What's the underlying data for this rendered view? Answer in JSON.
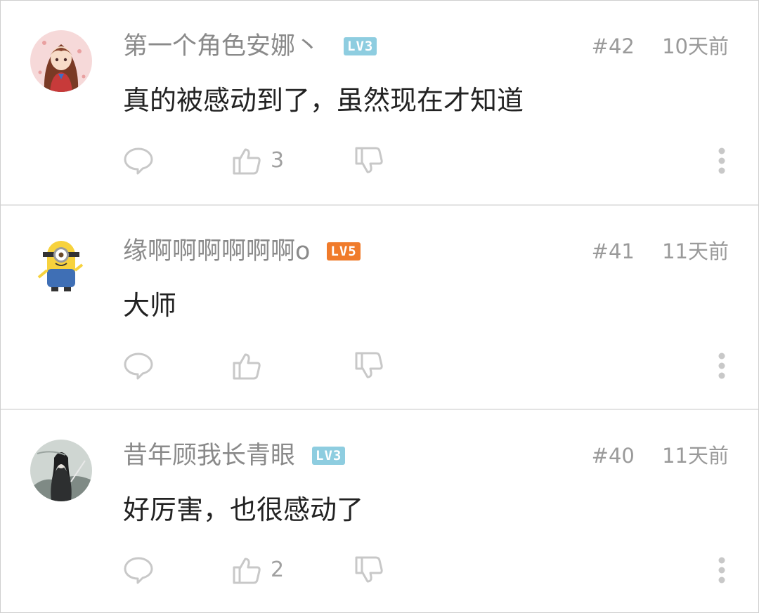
{
  "comments": [
    {
      "username": "第一个角色安娜丶",
      "level": "LV3",
      "floor": "#42",
      "time": "10天前",
      "text": "真的被感动到了，虽然现在才知道",
      "likes": "3",
      "avatar_icon": "anime-girl-avatar",
      "level_color": "#8ecde0"
    },
    {
      "username": "缘啊啊啊啊啊啊o",
      "level": "LV5",
      "floor": "#41",
      "time": "11天前",
      "text": "大师",
      "likes": "",
      "avatar_icon": "minion-avatar",
      "level_color": "#f07b2b"
    },
    {
      "username": "昔年顾我长青眼",
      "level": "LV3",
      "floor": "#40",
      "time": "11天前",
      "text": "好厉害，也很感动了",
      "likes": "2",
      "avatar_icon": "ink-warrior-avatar",
      "level_color": "#8ecde0"
    }
  ],
  "icons": {
    "reply": "speech-bubble-icon",
    "like": "thumbs-up-icon",
    "dislike": "thumbs-down-icon",
    "more": "vertical-dots-icon"
  },
  "colors": {
    "username": "#8a8a8a",
    "text": "#222222",
    "meta": "#9a9a9a",
    "icon": "#c8c8c8"
  }
}
